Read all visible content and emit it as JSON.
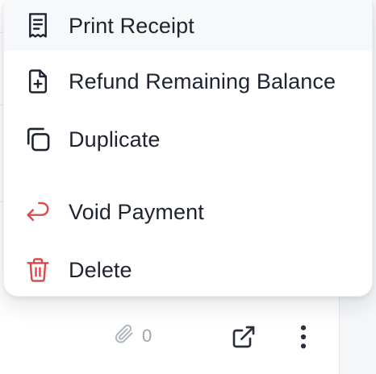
{
  "menu": {
    "items": [
      {
        "label": "Print Receipt",
        "icon": "receipt-icon"
      },
      {
        "label": "Refund Remaining Balance",
        "icon": "file-plus-icon"
      },
      {
        "label": "Duplicate",
        "icon": "copy-icon"
      },
      {
        "label": "Void Payment",
        "icon": "undo-arrow-icon"
      },
      {
        "label": "Delete",
        "icon": "trash-icon"
      }
    ]
  },
  "toolbar": {
    "attachment_count": "0",
    "attachment_icon": "paperclip-icon",
    "open_icon": "external-link-icon",
    "more_icon": "more-vertical-icon"
  },
  "colors": {
    "text": "#1f2330",
    "danger": "#dc4b4b",
    "muted": "#a0a6b0"
  }
}
